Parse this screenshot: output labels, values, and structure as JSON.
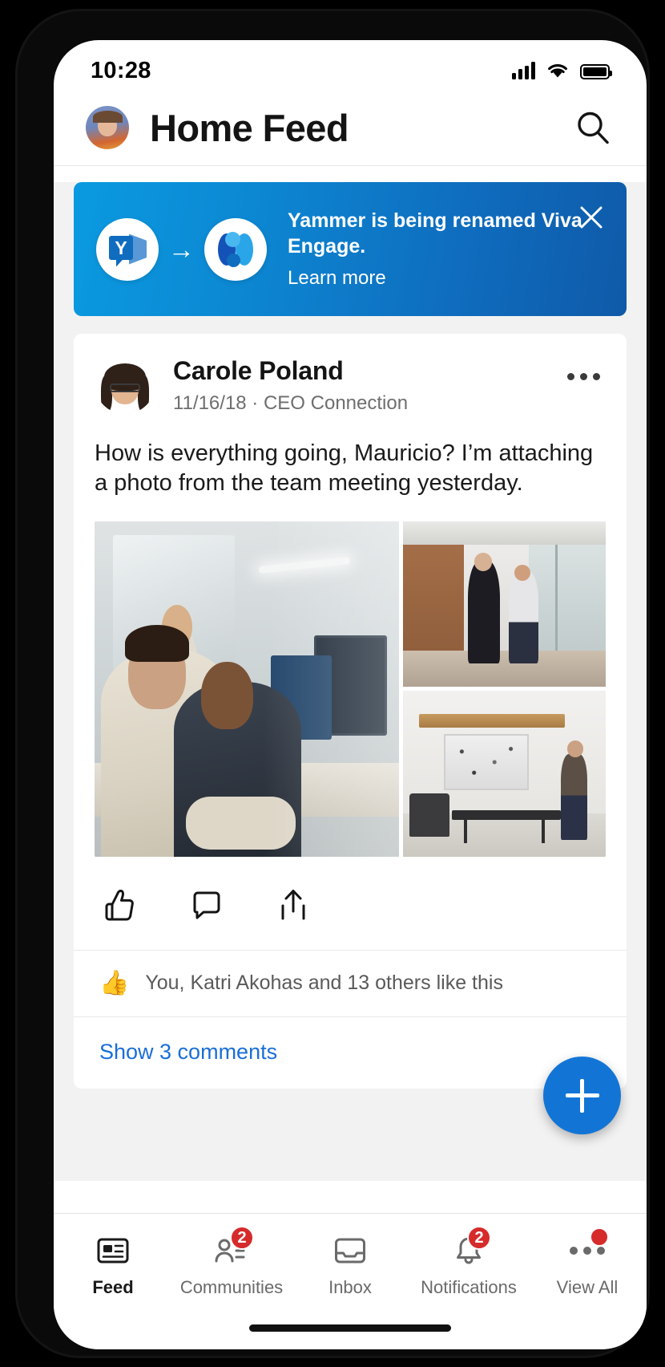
{
  "status_bar": {
    "time": "10:28",
    "signal_icon": "cellular-signal-icon",
    "wifi_icon": "wifi-icon",
    "battery_icon": "battery-full-icon"
  },
  "header": {
    "title": "Home Feed",
    "avatar_icon": "user-avatar",
    "search_icon": "search-icon"
  },
  "promo_banner": {
    "title": "Yammer is being renamed Viva Engage.",
    "link_label": "Learn more",
    "close_icon": "close-icon",
    "from_logo": "yammer-logo",
    "to_logo": "viva-engage-logo",
    "arrow_icon": "arrow-right-icon",
    "bg_start": "#0a9ae0",
    "bg_end": "#0f5aa8"
  },
  "post": {
    "author": "Carole Poland",
    "subtitle": "11/16/18 · CEO Connection",
    "body": "How is everything going, Mauricio? I’m attaching a photo from the team meeting yesterday.",
    "more_icon": "more-options-icon",
    "avatar_icon": "author-avatar",
    "attachments": [
      {
        "name": "team-meeting-photo-main",
        "alt": "Colleagues working at desks with monitors"
      },
      {
        "name": "office-corridor-photo",
        "alt": "Two people walking down an office corridor"
      },
      {
        "name": "office-lounge-photo",
        "alt": "Person standing at a table in an office lounge"
      }
    ],
    "actions": [
      {
        "name": "like-button",
        "icon": "thumbs-up-icon"
      },
      {
        "name": "comment-button",
        "icon": "comment-bubble-icon"
      },
      {
        "name": "share-button",
        "icon": "share-icon"
      }
    ],
    "likes_emoji": "👍",
    "likes_text": "You, Katri Akohas and 13 others like this",
    "comments_link": "Show 3 comments",
    "comments_link_color": "#1a6ed8"
  },
  "fab": {
    "icon": "plus-icon",
    "color": "#1275d6"
  },
  "bottom_nav": {
    "items": [
      {
        "label": "Feed",
        "icon": "feed-icon",
        "active": true,
        "badge": null
      },
      {
        "label": "Communities",
        "icon": "communities-icon",
        "active": false,
        "badge": "2"
      },
      {
        "label": "Inbox",
        "icon": "inbox-icon",
        "active": false,
        "badge": null
      },
      {
        "label": "Notifications",
        "icon": "bell-icon",
        "active": false,
        "badge": "2"
      },
      {
        "label": "View All",
        "icon": "more-horizontal-icon",
        "active": false,
        "badge": "dot"
      }
    ],
    "badge_color": "#d62b2b"
  }
}
